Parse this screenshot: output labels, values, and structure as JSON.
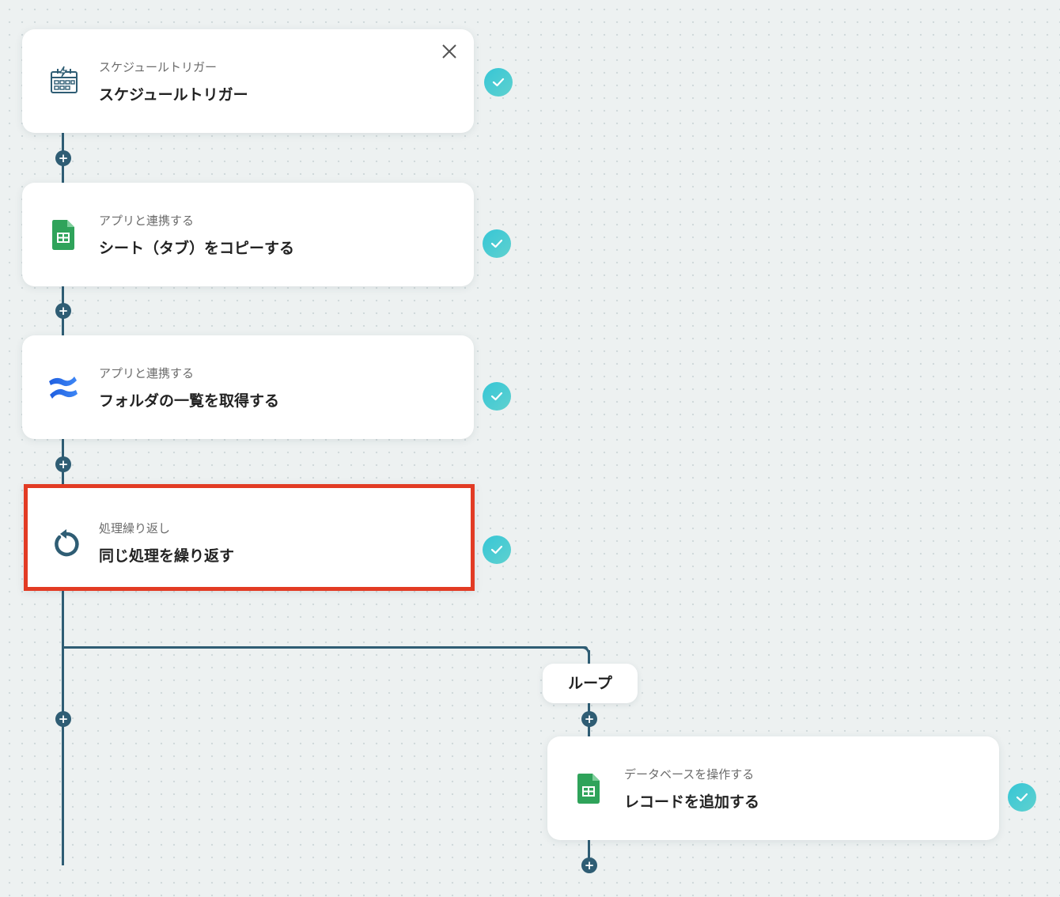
{
  "steps": [
    {
      "subtitle": "スケジュールトリガー",
      "title": "スケジュールトリガー",
      "icon": "schedule-calendar-icon"
    },
    {
      "subtitle": "アプリと連携する",
      "title": "シート（タブ）をコピーする",
      "icon": "google-sheets-icon"
    },
    {
      "subtitle": "アプリと連携する",
      "title": "フォルダの一覧を取得する",
      "icon": "confluence-icon"
    },
    {
      "subtitle": "処理繰り返し",
      "title": "同じ処理を繰り返す",
      "icon": "loop-arrow-icon"
    },
    {
      "subtitle": "データベースを操作する",
      "title": "レコードを追加する",
      "icon": "google-sheets-icon"
    }
  ],
  "loop_label": "ループ",
  "colors": {
    "connector": "#2f5d74",
    "check": "#36c6d6",
    "highlight": "#e23b24",
    "sheets_green": "#2fa35a"
  }
}
